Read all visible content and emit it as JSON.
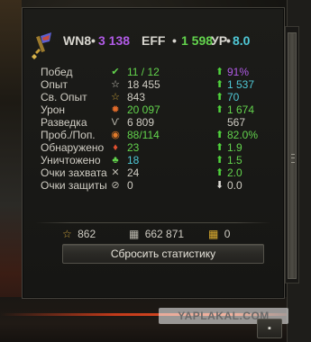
{
  "header": {
    "wn8_label": "WN8",
    "wn8_dot": "•",
    "wn8_value": "3 138",
    "eff_label": "EFF",
    "eff_dot": "•",
    "eff_value": "1 598",
    "yp_label": "УР",
    "yp_dot": "•",
    "yp_value": "8.0"
  },
  "colors": {
    "purple": "#b15be6",
    "green": "#63d44d",
    "cyan": "#4fc8d6",
    "gray": "#bdbab0",
    "arrow_green": "#4fd13c",
    "arrow_white": "#dcdad4"
  },
  "stats": [
    {
      "label": "Побед",
      "icon": "check-icon",
      "value": "11 / 12",
      "value_color": "#63d44d",
      "arrow": "up",
      "delta": "91%",
      "delta_color": "#b15be6"
    },
    {
      "label": "Опыт",
      "icon": "star-outline-icon",
      "value": "18 455",
      "value_color": "#d0cdc4",
      "arrow": "up",
      "delta": "1 537",
      "delta_color": "#4fc8d6"
    },
    {
      "label": "Св. Опыт",
      "icon": "free-xp-star-icon",
      "value": "843",
      "value_color": "#d0cdc4",
      "arrow": "up",
      "delta": "70",
      "delta_color": "#4fc8d6"
    },
    {
      "label": "Урон",
      "icon": "explosion-icon",
      "value": "20 097",
      "value_color": "#63d44d",
      "arrow": "up",
      "delta": "1 674",
      "delta_color": "#63d44d"
    },
    {
      "label": "Разведка",
      "icon": "spotting-icon",
      "value": "6 809",
      "value_color": "#d0cdc4",
      "arrow": "none",
      "delta": "567",
      "delta_color": "#d0cdc4"
    },
    {
      "label": "Проб./Поп.",
      "icon": "penetration-icon",
      "value": "88/114",
      "value_color": "#63d44d",
      "arrow": "up",
      "delta": "82.0%",
      "delta_color": "#63d44d"
    },
    {
      "label": "Обнаружено",
      "icon": "detected-icon",
      "value": "23",
      "value_color": "#63d44d",
      "arrow": "up",
      "delta": "1.9",
      "delta_color": "#63d44d"
    },
    {
      "label": "Уничтожено",
      "icon": "destroyed-tank-icon",
      "value": "18",
      "value_color": "#4fc8d6",
      "arrow": "up",
      "delta": "1.5",
      "delta_color": "#63d44d"
    },
    {
      "label": "Очки захвата",
      "icon": "capture-swords-icon",
      "value": "24",
      "value_color": "#d0cdc4",
      "arrow": "up",
      "delta": "2.0",
      "delta_color": "#63d44d"
    },
    {
      "label": "Очки защиты",
      "icon": "defense-shield-icon",
      "value": "0",
      "value_color": "#d0cdc4",
      "arrow": "down",
      "delta": "0.0",
      "delta_color": "#d0cdc4"
    }
  ],
  "totals": {
    "free_xp": "862",
    "credits": "662 871",
    "gold": "0"
  },
  "reset_button_label": "Сбросить статистику",
  "watermark": "YAPLAKAL.COM"
}
